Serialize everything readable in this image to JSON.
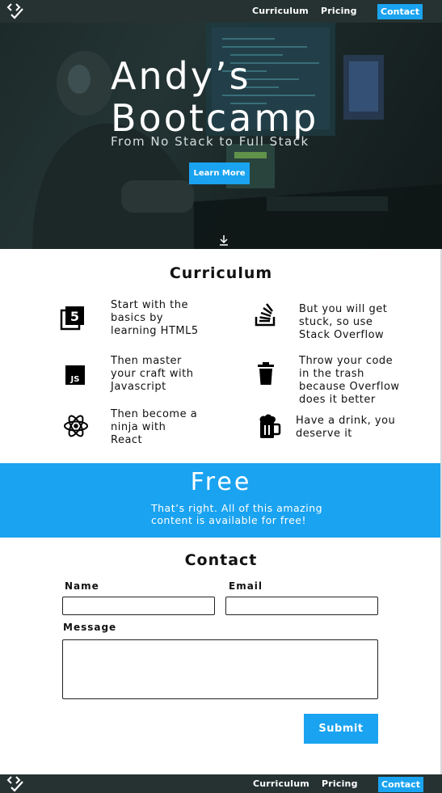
{
  "nav": {
    "links": [
      "Curriculum",
      "Pricing"
    ],
    "contact_label": "Contact"
  },
  "hero": {
    "title_line1": "Andy’s",
    "title_line2": "Bootcamp",
    "subtitle": "From No Stack to Full Stack",
    "button_label": "Learn More"
  },
  "curriculum": {
    "title": "Curriculum",
    "items": [
      {
        "icon": "html5-icon",
        "text": [
          "Start with the",
          "basics by",
          "learning HTML5"
        ]
      },
      {
        "icon": "stack-overflow-icon",
        "text": [
          "But you will get",
          "stuck, so use",
          "Stack Overflow"
        ]
      },
      {
        "icon": "javascript-icon",
        "text": [
          "Then master",
          "your craft with",
          "Javascript"
        ]
      },
      {
        "icon": "trash-icon",
        "text": [
          "Throw your code",
          "in the trash",
          "because Overflow",
          "does it better"
        ]
      },
      {
        "icon": "react-icon",
        "text": [
          "Then become a",
          "ninja with",
          "React"
        ]
      },
      {
        "icon": "beer-icon",
        "text": [
          "Have a drink, you",
          "deserve it"
        ]
      }
    ]
  },
  "free": {
    "title": "Free",
    "text_line1": "That’s right. All of this amazing",
    "text_line2": "content is available for free!"
  },
  "contact": {
    "title": "Contact",
    "name_label": "Name",
    "email_label": "Email",
    "message_label": "Message",
    "submit_label": "Submit"
  },
  "colors": {
    "accent": "#1aa3f0",
    "navbar": "#263231"
  }
}
